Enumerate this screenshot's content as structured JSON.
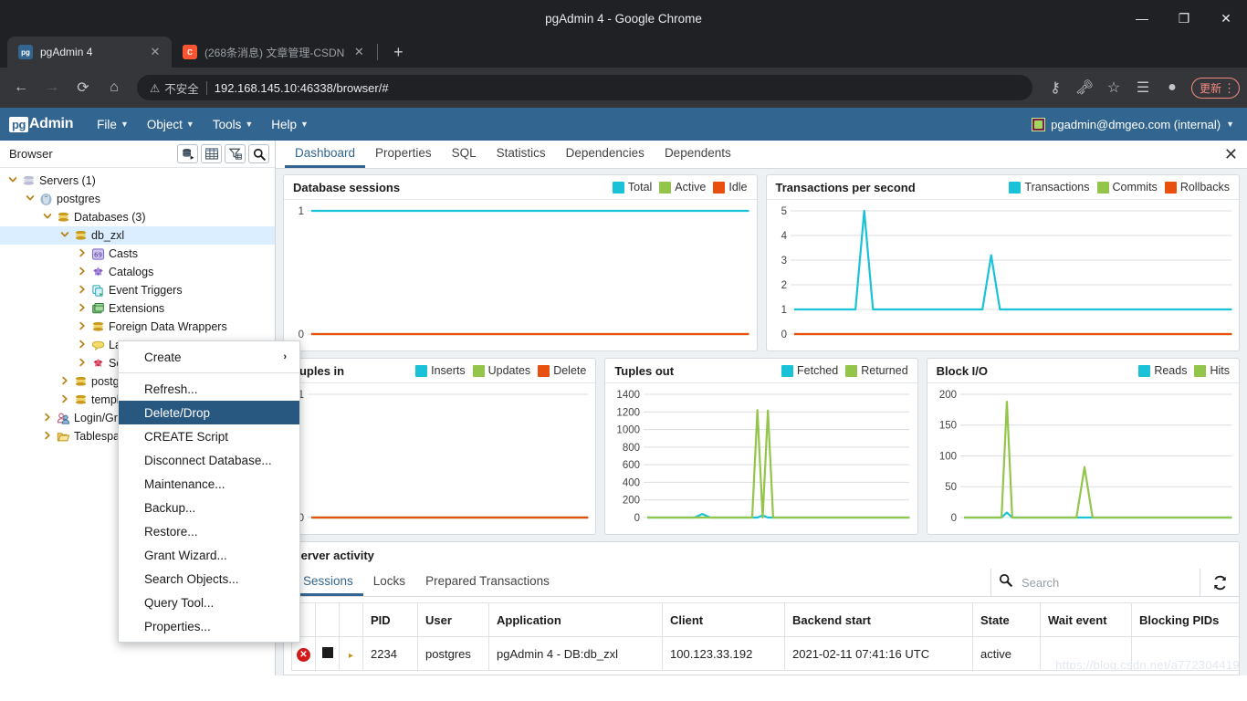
{
  "browser_window": {
    "title": "pgAdmin 4 - Google Chrome",
    "minimize": "—",
    "restore": "❐",
    "close": "✕",
    "tabs": [
      {
        "label": "pgAdmin 4",
        "favicon": "pg",
        "close": "✕",
        "active": true
      },
      {
        "label": "(268条消息) 文章管理-CSDN",
        "favicon": "C",
        "close": "✕",
        "active": false
      }
    ],
    "new_tab": "+",
    "omnibox": {
      "warning_icon": "⚠",
      "security_label": "不安全",
      "url": "192.168.145.10:46338/browser/#"
    },
    "update_label": "更新",
    "menu_dots": "⋮"
  },
  "pgadmin": {
    "logo_pg": "pg",
    "logo_admin": "Admin",
    "menus": [
      {
        "label": "File"
      },
      {
        "label": "Object"
      },
      {
        "label": "Tools"
      },
      {
        "label": "Help"
      }
    ],
    "user": "pgadmin@dmgeo.com (internal)"
  },
  "browser_panel": {
    "title": "Browser",
    "tools": [
      {
        "name": "query-tool-icon"
      },
      {
        "name": "view-data-icon"
      },
      {
        "name": "filter-icon"
      },
      {
        "name": "search-icon"
      }
    ],
    "tree": [
      {
        "label": "Servers (1)",
        "indent": 0,
        "twisty": "v",
        "icon": "servers",
        "selected": false
      },
      {
        "label": "postgres",
        "indent": 1,
        "twisty": "v",
        "icon": "postgres",
        "selected": false
      },
      {
        "label": "Databases (3)",
        "indent": 2,
        "twisty": "v",
        "icon": "databases",
        "selected": false
      },
      {
        "label": "db_zxl",
        "indent": 3,
        "twisty": "v",
        "icon": "database",
        "selected": true
      },
      {
        "label": "Casts",
        "indent": 4,
        "twisty": ">",
        "icon": "casts",
        "selected": false
      },
      {
        "label": "Catalogs",
        "indent": 4,
        "twisty": ">",
        "icon": "catalogs",
        "selected": false
      },
      {
        "label": "Event Triggers",
        "indent": 4,
        "twisty": ">",
        "icon": "eventtriggers",
        "selected": false
      },
      {
        "label": "Extensions",
        "indent": 4,
        "twisty": ">",
        "icon": "extensions",
        "selected": false
      },
      {
        "label": "Foreign Data Wrappers",
        "indent": 4,
        "twisty": ">",
        "icon": "fdw",
        "selected": false
      },
      {
        "label": "Languages",
        "indent": 4,
        "twisty": ">",
        "icon": "languages",
        "selected": false
      },
      {
        "label": "Schemas",
        "indent": 4,
        "twisty": ">",
        "icon": "schemas",
        "selected": false
      },
      {
        "label": "postgres",
        "indent": 3,
        "twisty": ">",
        "icon": "database",
        "selected": false
      },
      {
        "label": "template1",
        "indent": 3,
        "twisty": ">",
        "icon": "database",
        "selected": false
      },
      {
        "label": "Login/Group Roles",
        "indent": 2,
        "twisty": ">",
        "icon": "roles",
        "selected": false
      },
      {
        "label": "Tablespaces",
        "indent": 2,
        "twisty": ">",
        "icon": "tablespaces",
        "selected": false
      }
    ]
  },
  "context_menu": {
    "items": [
      {
        "label": "Create",
        "submenu": "›",
        "highlight": false,
        "separator_after": true
      },
      {
        "label": "Refresh...",
        "highlight": false
      },
      {
        "label": "Delete/Drop",
        "highlight": true
      },
      {
        "label": "CREATE Script",
        "highlight": false
      },
      {
        "label": "Disconnect Database...",
        "highlight": false
      },
      {
        "label": "Maintenance...",
        "highlight": false
      },
      {
        "label": "Backup...",
        "highlight": false
      },
      {
        "label": "Restore...",
        "highlight": false
      },
      {
        "label": "Grant Wizard...",
        "highlight": false
      },
      {
        "label": "Search Objects...",
        "highlight": false
      },
      {
        "label": "Query Tool...",
        "highlight": false
      },
      {
        "label": "Properties...",
        "highlight": false
      }
    ]
  },
  "object_tabs": {
    "items": [
      {
        "label": "Dashboard",
        "active": true
      },
      {
        "label": "Properties",
        "active": false
      },
      {
        "label": "SQL",
        "active": false
      },
      {
        "label": "Statistics",
        "active": false
      },
      {
        "label": "Dependencies",
        "active": false
      },
      {
        "label": "Dependents",
        "active": false
      }
    ],
    "close": "✕"
  },
  "colors": {
    "accent": "#326690",
    "cyan": "#1ac2d8",
    "green": "#93c54b",
    "red": "#e8500e",
    "highlight": "#28577f",
    "selected_row": "#dbeeff"
  },
  "chart_data": [
    {
      "type": "line",
      "title": "Database sessions",
      "ylim": [
        0,
        1
      ],
      "yticks": [
        0,
        1
      ],
      "grid": false,
      "legend_position": "top-right",
      "legend": [
        "Total",
        "Active",
        "Idle"
      ],
      "colors": [
        "#1ac2d8",
        "#93c54b",
        "#e8500e"
      ],
      "x": [
        0,
        10,
        20,
        30,
        40,
        50,
        60,
        70,
        80,
        90,
        100
      ],
      "series": [
        {
          "name": "Total",
          "values": [
            1,
            1,
            1,
            1,
            1,
            1,
            1,
            1,
            1,
            1,
            1
          ]
        },
        {
          "name": "Active",
          "values": [
            0,
            0,
            0,
            0,
            0,
            0,
            0,
            0,
            0,
            0,
            0
          ]
        },
        {
          "name": "Idle",
          "values": [
            0,
            0,
            0,
            0,
            0,
            0,
            0,
            0,
            0,
            0,
            0
          ]
        }
      ]
    },
    {
      "type": "line",
      "title": "Transactions per second",
      "ylim": [
        0,
        5
      ],
      "yticks": [
        0,
        1,
        2,
        3,
        4,
        5
      ],
      "grid": true,
      "legend_position": "top-right",
      "legend": [
        "Transactions",
        "Commits",
        "Rollbacks"
      ],
      "colors": [
        "#1ac2d8",
        "#93c54b",
        "#e8500e"
      ],
      "x": [
        0,
        8,
        14,
        16,
        18,
        24,
        30,
        38,
        43,
        45,
        47,
        55,
        65,
        75,
        85,
        100
      ],
      "series": [
        {
          "name": "Transactions",
          "values": [
            1,
            1,
            1,
            5,
            1,
            1,
            1,
            1,
            1,
            3.2,
            1,
            1,
            1,
            1,
            1,
            1
          ]
        },
        {
          "name": "Commits",
          "values": [
            0,
            0,
            0,
            0,
            0,
            0,
            0,
            0,
            0,
            0,
            0,
            0,
            0,
            0,
            0,
            0
          ]
        },
        {
          "name": "Rollbacks",
          "values": [
            0,
            0,
            0,
            0,
            0,
            0,
            0,
            0,
            0,
            0,
            0,
            0,
            0,
            0,
            0,
            0
          ]
        }
      ]
    },
    {
      "type": "line",
      "title": "Tuples in",
      "ylim": [
        0,
        1
      ],
      "yticks": [
        0,
        1
      ],
      "grid": true,
      "legend_position": "top-right",
      "legend": [
        "Inserts",
        "Updates",
        "Delete"
      ],
      "colors": [
        "#1ac2d8",
        "#93c54b",
        "#e8500e"
      ],
      "x": [
        0,
        20,
        40,
        60,
        80,
        100
      ],
      "series": [
        {
          "name": "Inserts",
          "values": [
            0,
            0,
            0,
            0,
            0,
            0
          ]
        },
        {
          "name": "Updates",
          "values": [
            0,
            0,
            0,
            0,
            0,
            0
          ]
        },
        {
          "name": "Delete",
          "values": [
            0,
            0,
            0,
            0,
            0,
            0
          ]
        }
      ]
    },
    {
      "type": "line",
      "title": "Tuples out",
      "ylim": [
        0,
        1400
      ],
      "yticks": [
        0,
        200,
        400,
        600,
        800,
        1000,
        1200,
        1400
      ],
      "grid": true,
      "legend_position": "top-right",
      "legend": [
        "Fetched",
        "Returned"
      ],
      "colors": [
        "#1ac2d8",
        "#93c54b"
      ],
      "x": [
        0,
        10,
        18,
        21,
        24,
        30,
        40,
        42,
        44,
        46,
        48,
        60,
        80,
        100
      ],
      "series": [
        {
          "name": "Fetched",
          "values": [
            0,
            0,
            0,
            40,
            0,
            0,
            0,
            0,
            25,
            0,
            0,
            0,
            0,
            0
          ]
        },
        {
          "name": "Returned",
          "values": [
            0,
            0,
            0,
            0,
            0,
            0,
            0,
            1220,
            0,
            1215,
            0,
            0,
            0,
            0
          ]
        }
      ]
    },
    {
      "type": "line",
      "title": "Block I/O",
      "ylim": [
        0,
        200
      ],
      "yticks": [
        0,
        50,
        100,
        150,
        200
      ],
      "grid": true,
      "legend_position": "top-right",
      "legend": [
        "Reads",
        "Hits"
      ],
      "colors": [
        "#1ac2d8",
        "#93c54b"
      ],
      "x": [
        0,
        8,
        14,
        16,
        18,
        20,
        30,
        42,
        45,
        48,
        60,
        80,
        100
      ],
      "series": [
        {
          "name": "Reads",
          "values": [
            0,
            0,
            0,
            8,
            0,
            0,
            0,
            0,
            0,
            0,
            0,
            0,
            0
          ]
        },
        {
          "name": "Hits",
          "values": [
            0,
            0,
            0,
            188,
            0,
            0,
            0,
            0,
            82,
            0,
            0,
            0,
            0
          ]
        }
      ]
    }
  ],
  "server_activity": {
    "title": "Server activity",
    "tabs": [
      {
        "label": "Sessions",
        "active": true
      },
      {
        "label": "Locks",
        "active": false
      },
      {
        "label": "Prepared Transactions",
        "active": false
      }
    ],
    "search_placeholder": "Search",
    "search_value": "",
    "refresh_icon": "⟳",
    "columns": [
      "",
      "",
      "",
      "PID",
      "User",
      "Application",
      "Client",
      "Backend start",
      "State",
      "Wait event",
      "Blocking PIDs"
    ],
    "rows": [
      {
        "cancel": "✕",
        "terminate": "■",
        "expand": "▸",
        "pid": "2234",
        "user": "postgres",
        "application": "pgAdmin 4 - DB:db_zxl",
        "client": "100.123.33.192",
        "backend_start": "2021-02-11 07:41:16 UTC",
        "state": "active",
        "wait_event": "",
        "blocking_pids": ""
      }
    ]
  },
  "watermark": "https://blog.csdn.net/a772304419"
}
